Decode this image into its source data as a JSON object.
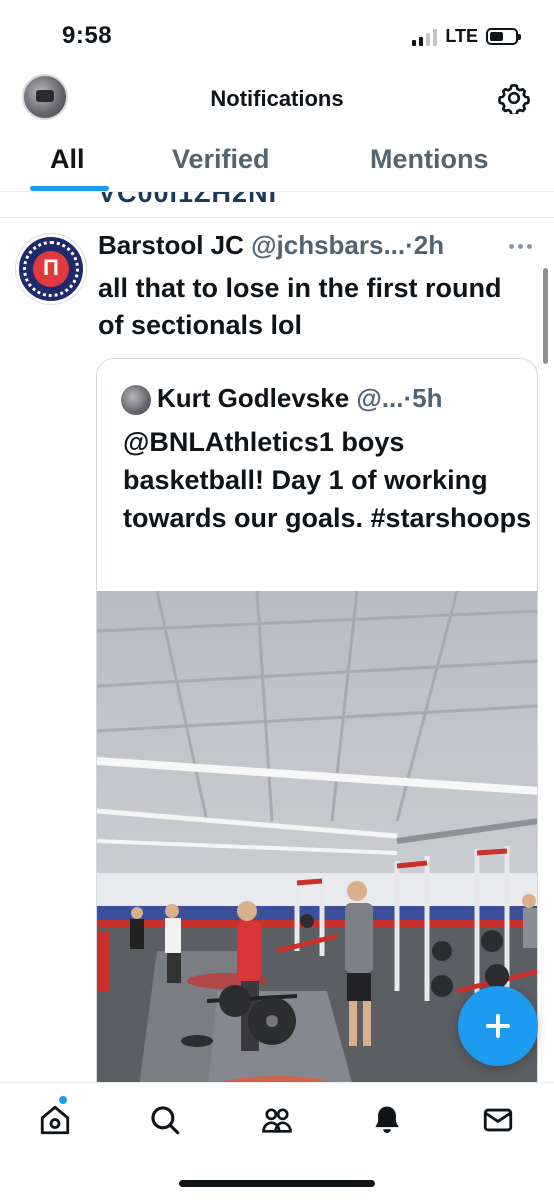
{
  "status_bar": {
    "time": "9:58",
    "network": "LTE"
  },
  "header": {
    "title": "Notifications"
  },
  "tabs": [
    {
      "label": "All",
      "active": true
    },
    {
      "label": "Verified",
      "active": false
    },
    {
      "label": "Mentions",
      "active": false
    }
  ],
  "previous_item": {
    "text_fragment": "VC00i1ZH2NI"
  },
  "tweet": {
    "name": "Barstool JC",
    "handle": "@jchsbars...",
    "separator": "·",
    "time": "2h",
    "text": "all that to lose in the first round of sectionals lol",
    "quote": {
      "name": "Kurt Godlevske",
      "handle": "@...",
      "separator": "·",
      "time": "5h",
      "text": "@BNLAthletics1 boys basketball!  Day 1 of working towards our goals. #starshoops"
    }
  },
  "colors": {
    "accent": "#1d9bf0",
    "text_primary": "#0f1419",
    "text_secondary": "#536471",
    "border": "#cfd9de"
  },
  "icons": {
    "settings": "gear-icon",
    "more": "more-dots-icon",
    "compose": "plus-icon",
    "nav": [
      "home-icon",
      "search-icon",
      "communities-icon",
      "bell-icon",
      "mail-icon"
    ]
  }
}
